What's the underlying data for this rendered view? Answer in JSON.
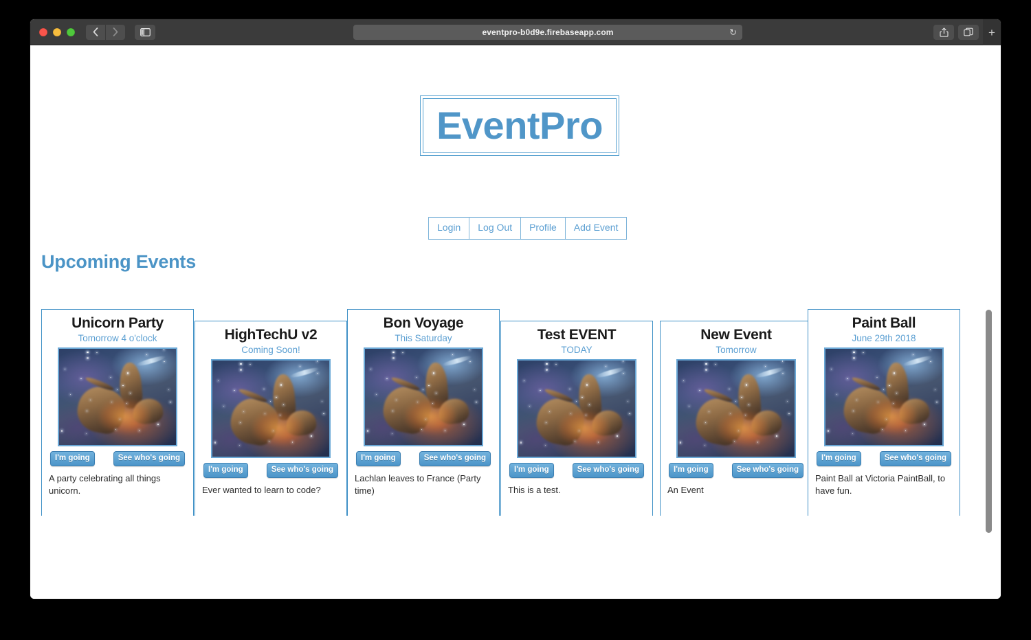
{
  "browser": {
    "url": "eventpro-b0d9e.firebaseapp.com",
    "reload_icon": "reload-icon",
    "back_icon": "chevron-left-icon",
    "forward_icon": "chevron-right-icon",
    "sidebar_icon": "sidebar-icon",
    "share_icon": "share-icon",
    "tabs_icon": "tab-overview-icon",
    "newtab_label": "+"
  },
  "site": {
    "logo": "EventPro",
    "accent_color": "#5096c8",
    "border_color": "#3f90c6",
    "button_color": "#4c95c9"
  },
  "nav": {
    "items": [
      {
        "label": "Login"
      },
      {
        "label": "Log Out"
      },
      {
        "label": "Profile"
      },
      {
        "label": "Add Event"
      }
    ]
  },
  "main": {
    "heading": "Upcoming Events",
    "going_label": "I'm going",
    "see_label": "See who's going",
    "events": [
      {
        "title": "Unicorn Party",
        "date": "Tomorrow 4 o'clock",
        "description": "A party celebrating all things unicorn.",
        "going_label": "I'm going",
        "see_label": "See who's going"
      },
      {
        "title": "HighTechU v2",
        "date": "Coming Soon!",
        "description": "Ever wanted to learn to code?",
        "going_label": "I'm going",
        "see_label": "See who's going"
      },
      {
        "title": "Bon Voyage",
        "date": "This Saturday",
        "description": "Lachlan leaves to France (Party time)",
        "going_label": "I'm going",
        "see_label": "See who's going"
      },
      {
        "title": "Test EVENT",
        "date": "TODAY",
        "description": "This is a test.",
        "going_label": "I'm going",
        "see_label": "See who's going"
      },
      {
        "title": "New Event",
        "date": "Tomorrow",
        "description": "An Event",
        "going_label": "I'm going",
        "see_label": "See who's going"
      },
      {
        "title": "Paint Ball",
        "date": "June 29th 2018",
        "description": "Paint Ball at Victoria PaintBall, to have fun.",
        "going_label": "I'm going",
        "see_label": "See who's going"
      }
    ]
  }
}
